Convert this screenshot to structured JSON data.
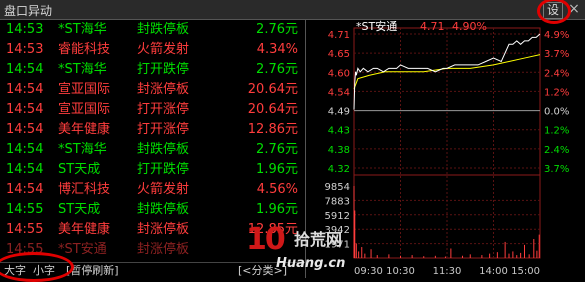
{
  "window": {
    "title": "盘口异动",
    "settings_label": "设",
    "close_label": "×"
  },
  "rows": [
    {
      "time": "14:53",
      "name": "*ST海华",
      "event": "封跌停板",
      "value": "2.76元",
      "color": "green"
    },
    {
      "time": "14:53",
      "name": "睿能科技",
      "event": "火箭发射",
      "value": "4.34%",
      "color": "red"
    },
    {
      "time": "14:54",
      "name": "*ST海华",
      "event": "打开跌停",
      "value": "2.76元",
      "color": "green"
    },
    {
      "time": "14:54",
      "name": "宣亚国际",
      "event": "封涨停板",
      "value": "20.64元",
      "color": "red"
    },
    {
      "time": "14:54",
      "name": "宣亚国际",
      "event": "打开涨停",
      "value": "20.64元",
      "color": "red"
    },
    {
      "time": "14:54",
      "name": "美年健康",
      "event": "打开涨停",
      "value": "12.86元",
      "color": "red"
    },
    {
      "time": "14:54",
      "name": "*ST海华",
      "event": "封跌停板",
      "value": "2.76元",
      "color": "green"
    },
    {
      "time": "14:54",
      "name": "ST天成",
      "event": "打开跌停",
      "value": "1.96元",
      "color": "green"
    },
    {
      "time": "14:54",
      "name": "博汇科技",
      "event": "火箭发射",
      "value": "4.56%",
      "color": "red"
    },
    {
      "time": "14:55",
      "name": "ST天成",
      "event": "封跌停板",
      "value": "1.96元",
      "color": "green"
    },
    {
      "time": "14:55",
      "name": "美年健康",
      "event": "封涨停板",
      "value": "12.85元",
      "color": "red"
    },
    {
      "time": "14:55",
      "name": "*ST安通",
      "event": "封涨停板",
      "value": "",
      "color": "red"
    }
  ],
  "bottom_bar": {
    "big_font": "大字",
    "small_font": "小字",
    "pause": "[暂停刷新]",
    "category": "[<分类>]"
  },
  "chart_data": {
    "type": "line",
    "title": "*ST安通",
    "header_price": "4.71",
    "header_change": "4.90%",
    "prev_close": 4.49,
    "ylim": [
      4.32,
      4.71
    ],
    "left_ticks": [
      "4.71",
      "4.65",
      "4.60",
      "4.54",
      "4.49",
      "4.43",
      "4.38",
      "4.32"
    ],
    "right_ticks": [
      "4.9%",
      "3.7%",
      "2.4%",
      "1.2%",
      "0.0%",
      "1.2%",
      "2.4%",
      "3.7%"
    ],
    "volume_ticks": [
      "9854",
      "7883",
      "5912",
      "3942",
      "1971"
    ],
    "x_ticks": [
      "09:30",
      "10:30",
      "11:30",
      "14:00",
      "15:00"
    ],
    "price_series": {
      "name": "price",
      "x": [
        0,
        1,
        2,
        3,
        5,
        8,
        12,
        18,
        25,
        30,
        38,
        45,
        55,
        60,
        70,
        80,
        95,
        105,
        115,
        120,
        130,
        140,
        150,
        160,
        170,
        180,
        190,
        200,
        205,
        210,
        215,
        220,
        225,
        230,
        235,
        240
      ],
      "values": [
        4.49,
        4.57,
        4.6,
        4.59,
        4.61,
        4.6,
        4.61,
        4.6,
        4.61,
        4.61,
        4.6,
        4.61,
        4.61,
        4.62,
        4.61,
        4.61,
        4.61,
        4.6,
        4.61,
        4.61,
        4.62,
        4.62,
        4.62,
        4.62,
        4.63,
        4.64,
        4.63,
        4.68,
        4.68,
        4.69,
        4.68,
        4.69,
        4.69,
        4.7,
        4.7,
        4.71
      ]
    },
    "avg_series": {
      "name": "avg",
      "x": [
        0,
        5,
        20,
        40,
        60,
        90,
        120,
        150,
        180,
        200,
        220,
        240
      ],
      "values": [
        4.55,
        4.58,
        4.59,
        4.6,
        4.6,
        4.6,
        4.61,
        4.61,
        4.62,
        4.63,
        4.64,
        4.65
      ]
    },
    "volume": {
      "x": [
        0,
        1,
        3,
        6,
        10,
        14,
        22,
        30,
        45,
        60,
        75,
        90,
        105,
        118,
        125,
        140,
        150,
        165,
        175,
        185,
        195,
        200,
        205,
        210,
        215,
        220,
        226,
        232,
        236,
        239
      ],
      "values": [
        9854,
        6500,
        2000,
        900,
        1500,
        600,
        1200,
        400,
        500,
        300,
        400,
        250,
        300,
        200,
        1300,
        300,
        500,
        400,
        600,
        800,
        2200,
        600,
        900,
        400,
        700,
        1800,
        500,
        2600,
        1000,
        3200
      ]
    }
  },
  "watermark": {
    "number": "10",
    "cn_text": "拾荒网",
    "url": "Huang.cn"
  },
  "colors": {
    "up": "#ff3d3d",
    "down": "#00dd00",
    "price_line": "#ffffff",
    "avg_line": "#ffff00",
    "annotation_circle": "#e00000"
  }
}
